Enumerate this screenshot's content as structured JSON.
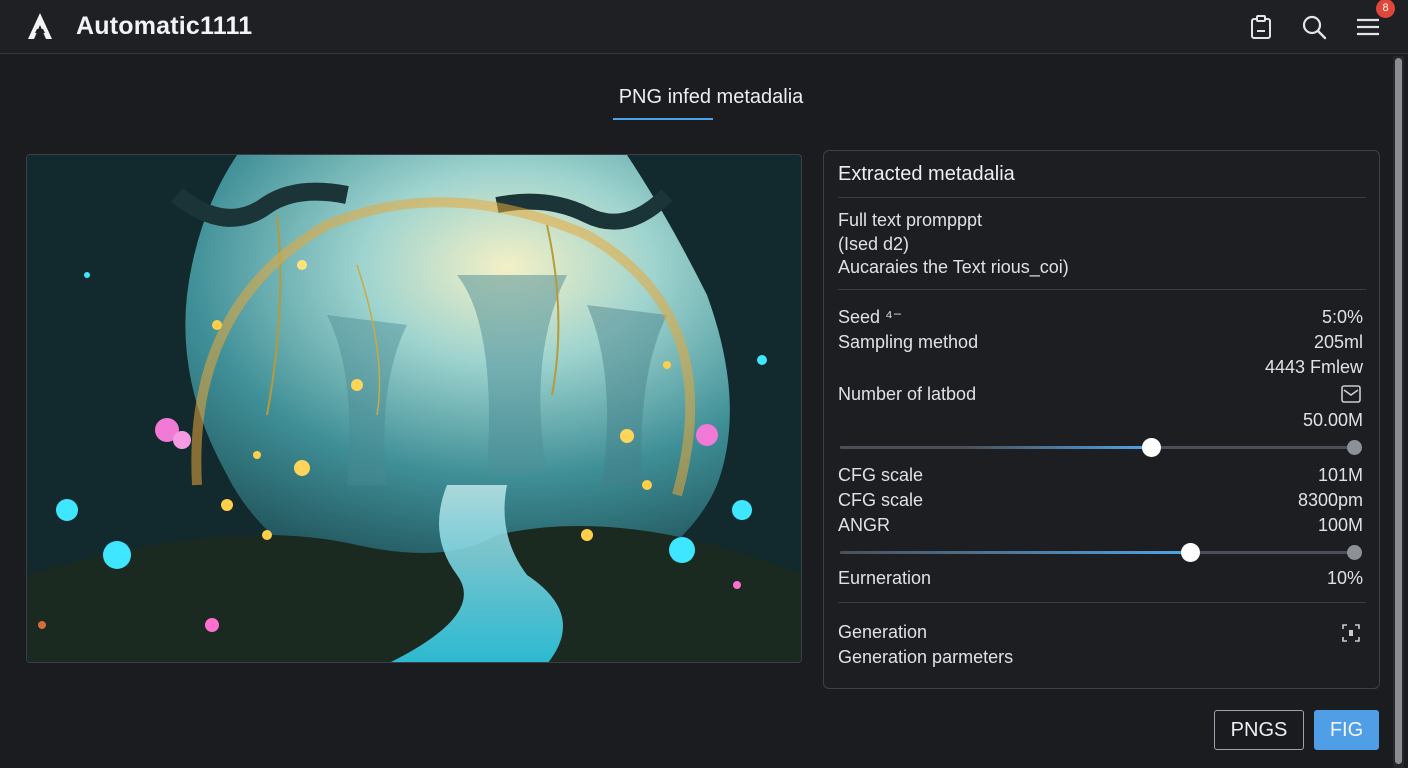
{
  "app": {
    "title": "Automatic1111",
    "notification_count": "8"
  },
  "header_icons": [
    "clipboard-icon",
    "search-icon",
    "hamburger-menu-icon"
  ],
  "tab": {
    "label": "PNG infed metadalia"
  },
  "image": {
    "description_icon": "generated-forest-image"
  },
  "metadata": {
    "title": "Extracted metadalia",
    "prompt_lines": [
      "Full text prompppt",
      "(Ised d2)",
      "Aucaraies the Text rious_coi)"
    ],
    "seed_label": "Seed ⁴⁻",
    "seed_value": "5:0%",
    "sampling_label": "Sampling method",
    "sampling_value": "205ml",
    "extra_value": "4443 Fmlew",
    "steps_label": "Number of latbod",
    "steps_value": "50.00M",
    "slider1": {
      "value": 0.606
    },
    "cfg1_label": "CFG scale",
    "cfg1_value": "101M",
    "cfg2_label": "CFG scale",
    "cfg2_value": "8300pm",
    "angr_label": "ANGR",
    "angr_value": "100M",
    "slider2": {
      "value": 0.681
    },
    "generation_label": "Eurneration",
    "generation_value": "10%",
    "gen_title": "Generation",
    "gen_params": "Generation parmeters"
  },
  "buttons": {
    "pngs": "PNGS",
    "fig": "FIG"
  },
  "colors": {
    "accent": "#4f9ee6",
    "slider_fill": "#4ea4e8",
    "badge": "#e0463a"
  }
}
